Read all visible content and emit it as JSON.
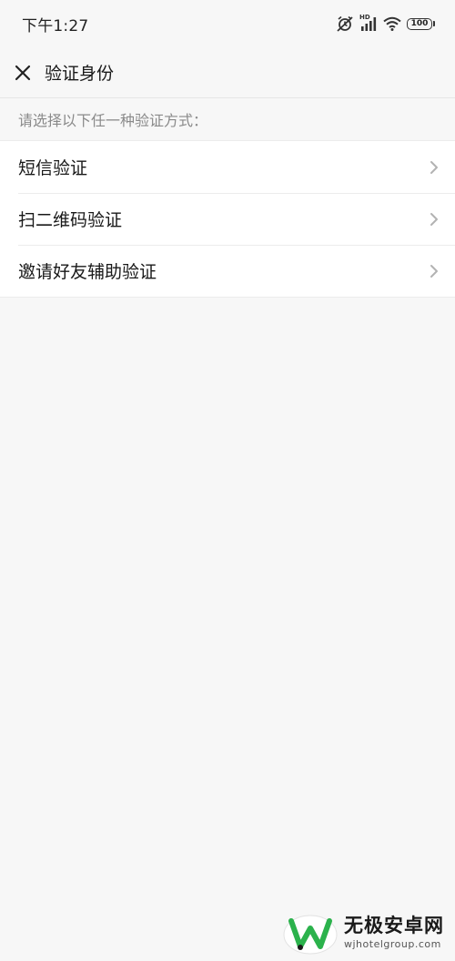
{
  "status_bar": {
    "time": "下午1:27",
    "network_label": "HD",
    "battery_level": "100",
    "icons": [
      "alarm-off-icon",
      "signal-icon",
      "wifi-icon",
      "battery-icon"
    ]
  },
  "nav": {
    "title": "验证身份",
    "close_icon": "close-icon"
  },
  "hint": "请选择以下任一种验证方式：",
  "options": [
    {
      "label": "短信验证"
    },
    {
      "label": "扫二维码验证"
    },
    {
      "label": "邀请好友辅助验证"
    }
  ],
  "watermark": {
    "name": "无极安卓网",
    "url": "wjhotelgroup.com"
  },
  "colors": {
    "background": "#f7f7f7",
    "card": "#ffffff",
    "hint_text": "#8a8a8a",
    "primary_text": "#181818",
    "chevron": "#b2b2b2",
    "logo_green": "#2bb24c"
  }
}
